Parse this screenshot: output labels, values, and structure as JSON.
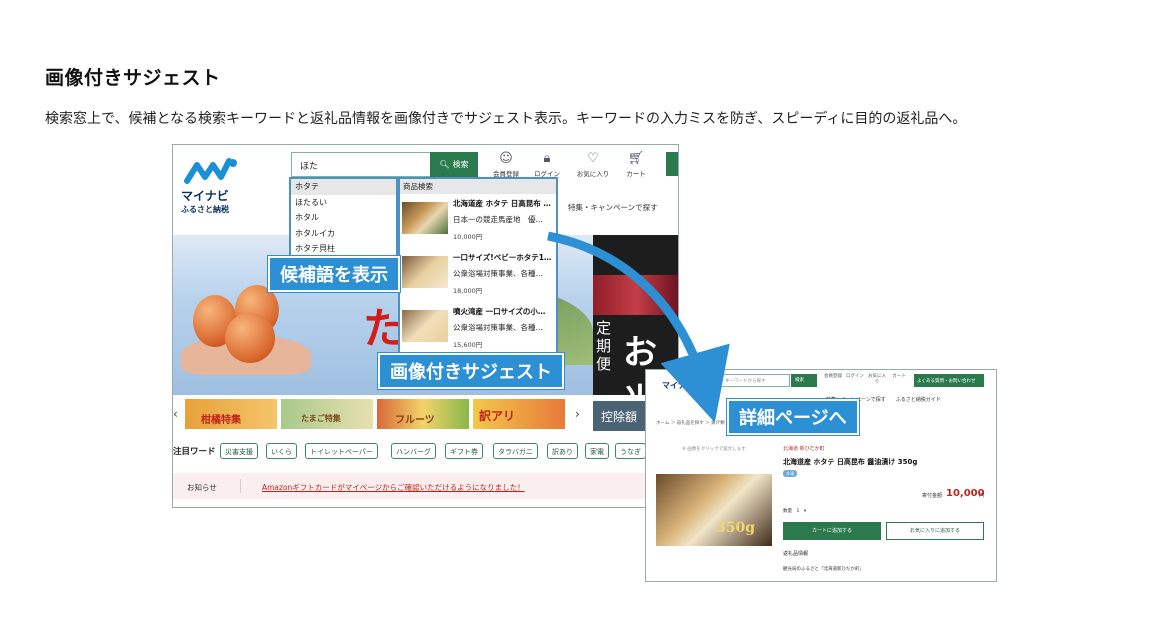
{
  "heading": "画像付きサジェスト",
  "description": "検索窓上で、候補となる検索キーワードと返礼品情報を画像付きでサジェスト表示。キーワードの入力ミスを防ぎ、スピーディに目的の返礼品へ。",
  "site": {
    "logo_name": "マイナビ",
    "logo_sub": "ふるさと納税",
    "search_value": "ほた",
    "search_button": "検索",
    "header_icons": [
      {
        "label": "会員登録",
        "icon": "user-icon"
      },
      {
        "label": "ログイン",
        "icon": "lock-icon"
      },
      {
        "label": "お気に入り",
        "icon": "heart-icon"
      },
      {
        "label": "カート",
        "icon": "cart-icon"
      }
    ],
    "nav_campaign": "特集・キャンペーンで探す",
    "suggest_keywords": [
      "ホタテ",
      "ほたるい",
      "ホタル",
      "ホタルイカ",
      "ホタテ貝柱"
    ],
    "suggest_products_header": "商品検索",
    "suggest_products": [
      {
        "name": "北海道産 ホタテ 日高昆布 …",
        "desc": "日本一の競走馬産地　優…",
        "price": "10,000円"
      },
      {
        "name": "一口サイズ!ベビーホタテ1…",
        "desc": "公衆浴場対策事業、各種…",
        "price": "18,000円"
      },
      {
        "name": "噴火湾産 一口サイズの小…",
        "desc": "公衆浴場対策事業、各種…",
        "price": "15,600円"
      }
    ],
    "banner_big": "たま",
    "banner_teiki": "定期便",
    "banner_okome": "お米",
    "thumb_labels": [
      "柑橘特集",
      "たまご特集",
      "フルーツ",
      "訳アリ"
    ],
    "kojou": "控除額",
    "keyword_label": "注目ワード",
    "keywords": [
      "災害支援",
      "いくら",
      "トイレットペーパー",
      "ハンバーグ",
      "ギフト券",
      "タラバガニ",
      "訳あり",
      "家電",
      "うなぎ"
    ],
    "notice_label": "お知らせ",
    "notice_text": "Amazonギフトカードがマイページからご確認いただけるようになりました！"
  },
  "callouts": {
    "candidates": "候補語を表示",
    "image_suggest": "画像付きサジェスト",
    "detail": "詳細ページへ"
  },
  "detail_page": {
    "logo": "マイナビ",
    "search_placeholder": "キーワードから探す",
    "search_button": "検索",
    "icons": [
      "会員登録",
      "ログイン",
      "お気に入り",
      "カート"
    ],
    "guide_button": "よくある質問・お問い合わせ",
    "nav": "特集・キャンペーンで探す　　ふるさと納税ガイド",
    "breadcrumb": "ホーム ＞ 返礼品を探す ＞ 魚介類・海",
    "image_hint": "※ 画像をクリックで拡大します",
    "region": "北海道 新ひだか町",
    "title": "北海道産 ホタテ 日高昆布 醤油漬け 350g",
    "badge": "冷凍",
    "image_price": "350g",
    "amount_label": "寄付金額",
    "amount": "10,000",
    "yen": "円",
    "qty_label": "数量　1　▾",
    "cart_button": "カートに追加する",
    "fav_button": "お気に入りに追加する",
    "info_heading": "返礼品情報",
    "info_text": "観光局のふるさと「北海道新ひだか町」"
  }
}
